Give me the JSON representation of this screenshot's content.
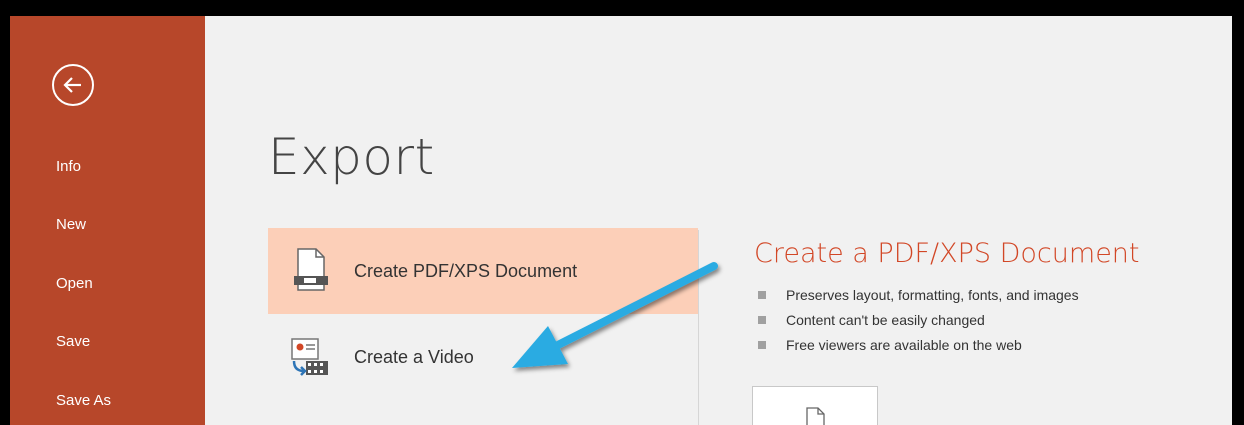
{
  "sidebar": {
    "back_icon": "back-arrow-icon",
    "items": [
      {
        "label": "Info"
      },
      {
        "label": "New"
      },
      {
        "label": "Open"
      },
      {
        "label": "Save"
      },
      {
        "label": "Save As"
      }
    ]
  },
  "main": {
    "title": "Export",
    "options": [
      {
        "label": "Create PDF/XPS Document",
        "icon": "pdf-document-icon",
        "selected": true
      },
      {
        "label": "Create a Video",
        "icon": "video-icon",
        "selected": false
      }
    ]
  },
  "detail": {
    "title": "Create a PDF/XPS Document",
    "bullets": [
      "Preserves layout, formatting, fonts, and images",
      "Content can't be easily changed",
      "Free viewers are available on the web"
    ]
  },
  "colors": {
    "sidebar_bg": "#b7472a",
    "selected_bg": "#fccfb8",
    "accent": "#d24726",
    "annotation_arrow": "#29abe2"
  }
}
